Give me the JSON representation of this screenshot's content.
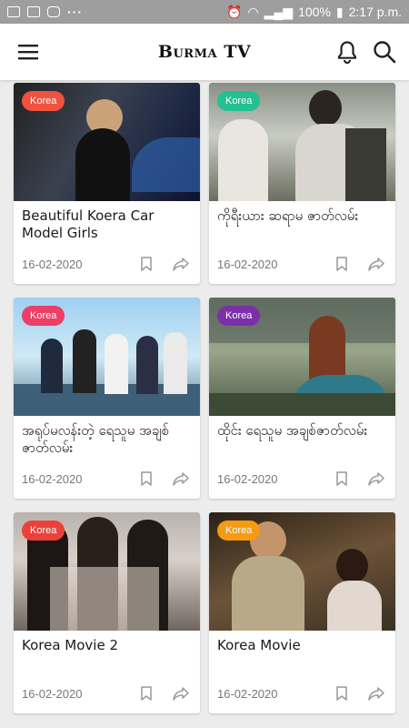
{
  "status_bar": {
    "battery": "100%",
    "time": "2:17 p.m."
  },
  "app": {
    "title": "Burma TV"
  },
  "icons": {
    "menu": "hamburger-menu-icon",
    "bell": "bell-icon",
    "search": "search-icon",
    "bookmark": "bookmark-icon",
    "share": "share-icon"
  },
  "cards": [
    {
      "category": "Korea",
      "badge_color": "#f0523f",
      "title": "Beautiful Koera Car Model Girls",
      "date": "16-02-2020"
    },
    {
      "category": "Korea",
      "badge_color": "#22c093",
      "title": "ကိုရီးယား ဆရာမ ဇာတ်လမ်း",
      "date": "16-02-2020"
    },
    {
      "category": "Korea",
      "badge_color": "#ec3f66",
      "title": "အရုပ်မလန်းတဲ့ ရေသူမ အချစ်ဇာတ်လမ်း",
      "date": "16-02-2020"
    },
    {
      "category": "Korea",
      "badge_color": "#7b2fa8",
      "title": "ထိုင်း ရေသူမ အချစ်ဇာတ်လမ်း",
      "date": "16-02-2020"
    },
    {
      "category": "Korea",
      "badge_color": "#ec4139",
      "title": "Korea Movie 2",
      "date": "16-02-2020"
    },
    {
      "category": "Korea",
      "badge_color": "#f59a12",
      "title": "Korea Movie",
      "date": "16-02-2020"
    }
  ]
}
